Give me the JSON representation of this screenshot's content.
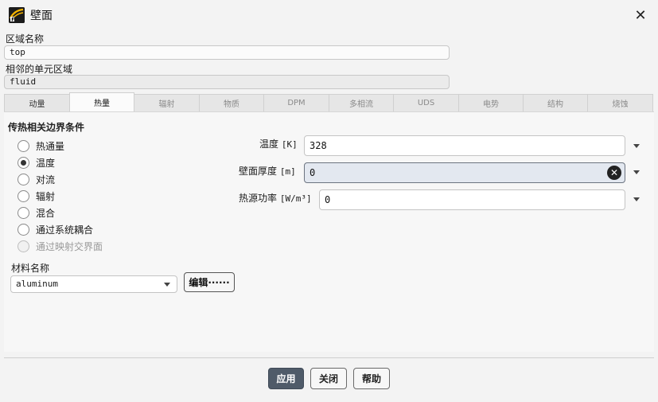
{
  "window": {
    "title": "壁面",
    "close_glyph": "✕"
  },
  "zone_name": {
    "label": "区域名称",
    "value": "top"
  },
  "adjacent_zone": {
    "label": "相邻的单元区域",
    "value": "fluid"
  },
  "tabs": [
    {
      "label": "动量",
      "state": "enabled"
    },
    {
      "label": "热量",
      "state": "active"
    },
    {
      "label": "辐射",
      "state": "disabled"
    },
    {
      "label": "物质",
      "state": "disabled"
    },
    {
      "label": "DPM",
      "state": "disabled"
    },
    {
      "label": "多相流",
      "state": "disabled"
    },
    {
      "label": "UDS",
      "state": "disabled"
    },
    {
      "label": "电势",
      "state": "disabled"
    },
    {
      "label": "结构",
      "state": "disabled"
    },
    {
      "label": "烧蚀",
      "state": "disabled"
    }
  ],
  "thermal": {
    "section_title": "传热相关边界条件",
    "options": [
      {
        "label": "热通量",
        "checked": false,
        "disabled": false
      },
      {
        "label": "温度",
        "checked": true,
        "disabled": false
      },
      {
        "label": "对流",
        "checked": false,
        "disabled": false
      },
      {
        "label": "辐射",
        "checked": false,
        "disabled": false
      },
      {
        "label": "混合",
        "checked": false,
        "disabled": false
      },
      {
        "label": "通过系统耦合",
        "checked": false,
        "disabled": false
      },
      {
        "label": "通过映射交界面",
        "checked": false,
        "disabled": true
      }
    ],
    "temperature": {
      "label": "温度",
      "unit": "[K]",
      "value": "328"
    },
    "wall_thickness": {
      "label": "壁面厚度",
      "unit": "[m]",
      "value": "0"
    },
    "heat_source": {
      "label": "热源功率",
      "unit": "[W/m³]",
      "value": "0"
    }
  },
  "material": {
    "label": "材料名称",
    "selected": "aluminum",
    "edit_label": "编辑······"
  },
  "buttons": {
    "apply": "应用",
    "close": "关闭",
    "help": "帮助"
  },
  "colors": {
    "primary_button": "#4f5b69",
    "focused_field": "#e3e8f0"
  }
}
